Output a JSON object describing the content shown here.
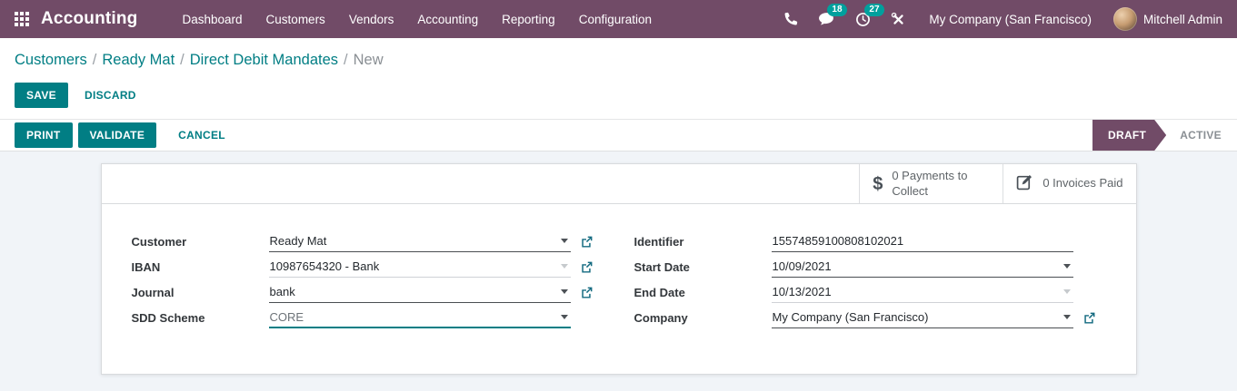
{
  "topbar": {
    "app_name": "Accounting",
    "menu": [
      "Dashboard",
      "Customers",
      "Vendors",
      "Accounting",
      "Reporting",
      "Configuration"
    ],
    "messages_count": "18",
    "activities_count": "27",
    "company": "My Company (San Francisco)",
    "user": "Mitchell Admin"
  },
  "breadcrumb": {
    "items": [
      "Customers",
      "Ready Mat",
      "Direct Debit Mandates"
    ],
    "current": "New",
    "separator": "/"
  },
  "actions": {
    "save": "SAVE",
    "discard": "DISCARD"
  },
  "statusbar": {
    "print": "PRINT",
    "validate": "VALIDATE",
    "cancel": "CANCEL",
    "states": [
      "DRAFT",
      "ACTIVE"
    ],
    "active_state": "DRAFT"
  },
  "stat_buttons": [
    {
      "icon": "dollar",
      "value": "0",
      "label": "Payments to Collect"
    },
    {
      "icon": "edit-pencil",
      "value": "0",
      "label": "Invoices Paid"
    }
  ],
  "form": {
    "left": [
      {
        "label": "Customer",
        "value": "Ready Mat"
      },
      {
        "label": "IBAN",
        "value": "10987654320 - Bank"
      },
      {
        "label": "Journal",
        "value": "bank"
      },
      {
        "label": "SDD Scheme",
        "value": "CORE"
      }
    ],
    "right": [
      {
        "label": "Identifier",
        "value": "15574859100808102021"
      },
      {
        "label": "Start Date",
        "value": "10/09/2021"
      },
      {
        "label": "End Date",
        "value": "10/13/2021"
      },
      {
        "label": "Company",
        "value": "My Company (San Francisco)"
      }
    ]
  },
  "icons": {
    "dollar": "$"
  },
  "colors": {
    "topbar_bg": "#714B67",
    "accent_teal": "#017E84",
    "badge_teal": "#00A09D",
    "draft_bg": "#714B67",
    "page_bg": "#f1f4f8",
    "ext_link": "#136a80"
  }
}
